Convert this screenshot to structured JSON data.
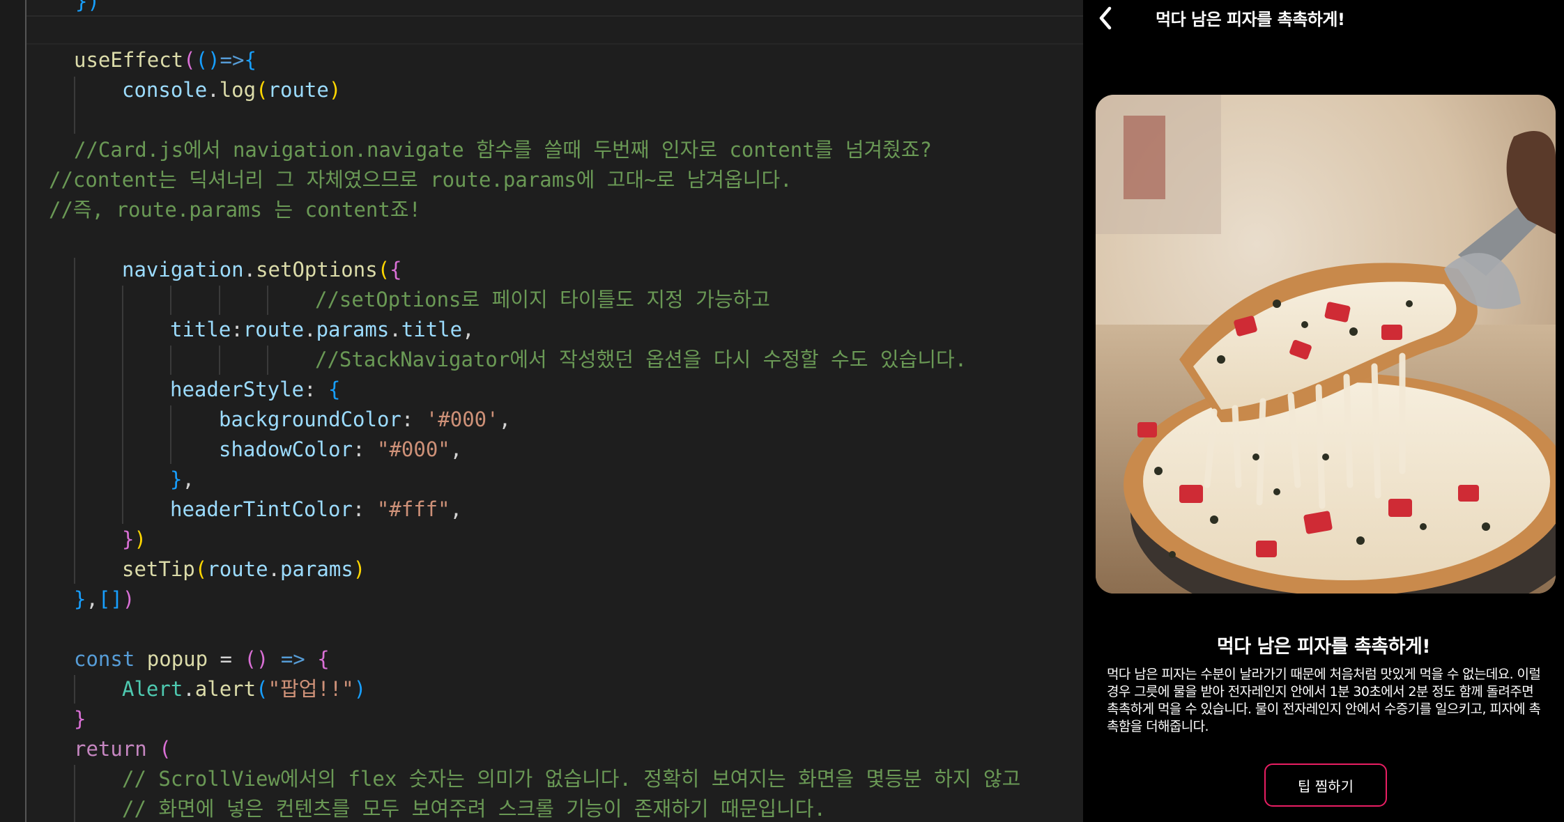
{
  "editor": {
    "lines": [
      {
        "id": "l00",
        "segs": [
          {
            "t": "})",
            "c": "k-br3"
          }
        ]
      },
      {
        "id": "l01",
        "segs": [
          {
            "t": "useEffect",
            "c": "k-fn"
          },
          {
            "t": "(",
            "c": "k-br2"
          },
          {
            "t": "()",
            "c": "k-br3"
          },
          {
            "t": "=>",
            "c": "k-kw"
          },
          {
            "t": "{",
            "c": "k-br3"
          }
        ]
      },
      {
        "id": "l02",
        "segs": [
          {
            "t": "console",
            "c": "k-var"
          },
          {
            "t": ".",
            "c": "k-plain"
          },
          {
            "t": "log",
            "c": "k-fn"
          },
          {
            "t": "(",
            "c": "k-br1"
          },
          {
            "t": "route",
            "c": "k-var"
          },
          {
            "t": ")",
            "c": "k-br1"
          }
        ]
      },
      {
        "id": "l03",
        "segs": []
      },
      {
        "id": "l04",
        "segs": [
          {
            "t": "//Card.js에서 navigation.navigate 함수를 쓸때 두번째 인자로 content를 넘겨줬죠?",
            "c": "k-cm"
          }
        ]
      },
      {
        "id": "l05",
        "segs": [
          {
            "t": "//content는 딕셔너리 그 자체였으므로 route.params에 고대~로 남겨옵니다.",
            "c": "k-cm"
          }
        ]
      },
      {
        "id": "l06",
        "segs": [
          {
            "t": "//즉, route.params 는 content죠!",
            "c": "k-cm"
          }
        ]
      },
      {
        "id": "l07",
        "segs": []
      },
      {
        "id": "l08",
        "segs": [
          {
            "t": "navigation",
            "c": "k-var"
          },
          {
            "t": ".",
            "c": "k-plain"
          },
          {
            "t": "setOptions",
            "c": "k-fn"
          },
          {
            "t": "(",
            "c": "k-br1"
          },
          {
            "t": "{",
            "c": "k-br2"
          }
        ]
      },
      {
        "id": "l09",
        "segs": [
          {
            "t": "//setOptions로 페이지 타이틀도 지정 가능하고",
            "c": "k-cm"
          }
        ]
      },
      {
        "id": "l10",
        "segs": [
          {
            "t": "title",
            "c": "k-var"
          },
          {
            "t": ":",
            "c": "k-plain"
          },
          {
            "t": "route",
            "c": "k-var"
          },
          {
            "t": ".",
            "c": "k-plain"
          },
          {
            "t": "params",
            "c": "k-var"
          },
          {
            "t": ".",
            "c": "k-plain"
          },
          {
            "t": "title",
            "c": "k-var"
          },
          {
            "t": ",",
            "c": "k-plain"
          }
        ]
      },
      {
        "id": "l11",
        "segs": [
          {
            "t": "//StackNavigator에서 작성했던 옵션을 다시 수정할 수도 있습니다.",
            "c": "k-cm"
          }
        ]
      },
      {
        "id": "l12",
        "segs": [
          {
            "t": "headerStyle",
            "c": "k-var"
          },
          {
            "t": ": ",
            "c": "k-plain"
          },
          {
            "t": "{",
            "c": "k-br3"
          }
        ]
      },
      {
        "id": "l13",
        "segs": [
          {
            "t": "backgroundColor",
            "c": "k-var"
          },
          {
            "t": ": ",
            "c": "k-plain"
          },
          {
            "t": "'#000'",
            "c": "k-str"
          },
          {
            "t": ",",
            "c": "k-plain"
          }
        ]
      },
      {
        "id": "l14",
        "segs": [
          {
            "t": "shadowColor",
            "c": "k-var"
          },
          {
            "t": ": ",
            "c": "k-plain"
          },
          {
            "t": "\"#000\"",
            "c": "k-str"
          },
          {
            "t": ",",
            "c": "k-plain"
          }
        ]
      },
      {
        "id": "l15",
        "segs": [
          {
            "t": "}",
            "c": "k-br3"
          },
          {
            "t": ",",
            "c": "k-plain"
          }
        ]
      },
      {
        "id": "l16",
        "segs": [
          {
            "t": "headerTintColor",
            "c": "k-var"
          },
          {
            "t": ": ",
            "c": "k-plain"
          },
          {
            "t": "\"#fff\"",
            "c": "k-str"
          },
          {
            "t": ",",
            "c": "k-plain"
          }
        ]
      },
      {
        "id": "l17",
        "segs": [
          {
            "t": "}",
            "c": "k-br2"
          },
          {
            "t": ")",
            "c": "k-br1"
          }
        ]
      },
      {
        "id": "l18",
        "segs": [
          {
            "t": "setTip",
            "c": "k-fn"
          },
          {
            "t": "(",
            "c": "k-br1"
          },
          {
            "t": "route",
            "c": "k-var"
          },
          {
            "t": ".",
            "c": "k-plain"
          },
          {
            "t": "params",
            "c": "k-var"
          },
          {
            "t": ")",
            "c": "k-br1"
          }
        ]
      },
      {
        "id": "l19",
        "segs": [
          {
            "t": "}",
            "c": "k-br3"
          },
          {
            "t": ",",
            "c": "k-plain"
          },
          {
            "t": "[]",
            "c": "k-br3"
          },
          {
            "t": ")",
            "c": "k-br2"
          }
        ]
      },
      {
        "id": "l20",
        "segs": []
      },
      {
        "id": "l21",
        "segs": [
          {
            "t": "const",
            "c": "k-kw"
          },
          {
            "t": " popup ",
            "c": "k-fn"
          },
          {
            "t": "= ",
            "c": "k-plain"
          },
          {
            "t": "()",
            "c": "k-br2"
          },
          {
            "t": " => ",
            "c": "k-kw"
          },
          {
            "t": "{",
            "c": "k-br2"
          }
        ]
      },
      {
        "id": "l22",
        "segs": [
          {
            "t": "Alert",
            "c": "k-obj"
          },
          {
            "t": ".",
            "c": "k-plain"
          },
          {
            "t": "alert",
            "c": "k-fn"
          },
          {
            "t": "(",
            "c": "k-br3"
          },
          {
            "t": "\"팝업!!\"",
            "c": "k-str"
          },
          {
            "t": ")",
            "c": "k-br3"
          }
        ]
      },
      {
        "id": "l23",
        "segs": [
          {
            "t": "}",
            "c": "k-br2"
          }
        ]
      },
      {
        "id": "l24",
        "segs": [
          {
            "t": "return",
            "c": "k-ctl"
          },
          {
            "t": " (",
            "c": "k-br2"
          }
        ]
      },
      {
        "id": "l25",
        "segs": [
          {
            "t": "// ScrollView에서의 flex 숫자는 의미가 없습니다. 정확히 보여지는 화면을 몇등분 하지 않고",
            "c": "k-cm"
          }
        ]
      },
      {
        "id": "l26",
        "segs": [
          {
            "t": "// 화면에 넣은 컨텐츠를 모두 보여주려 스크롤 기능이 존재하기 때문입니다.",
            "c": "k-cm"
          }
        ]
      }
    ]
  },
  "phone": {
    "header_title": "먹다 남은 피자를 촉촉하게!",
    "back_icon": "chevron-left-icon",
    "image_alt": "pizza-slice-photo",
    "content_title": "먹다 남은 피자를 촉촉하게!",
    "content_desc": "먹다 남은 피자는 수분이 날라가기 때문에 처음처럼 맛있게 먹을 수 없는데요. 이럴 경우 그릇에 물을 받아 전자레인지 안에서 1분 30초에서 2분 정도 함께 돌려주면 촉촉하게 먹을 수 있습니다. 물이 전자레인지 안에서 수증기를 일으키고, 피자에 촉촉함을 더해줍니다.",
    "button_label": "팁 찜하기",
    "button_border_color": "#e91e63"
  }
}
